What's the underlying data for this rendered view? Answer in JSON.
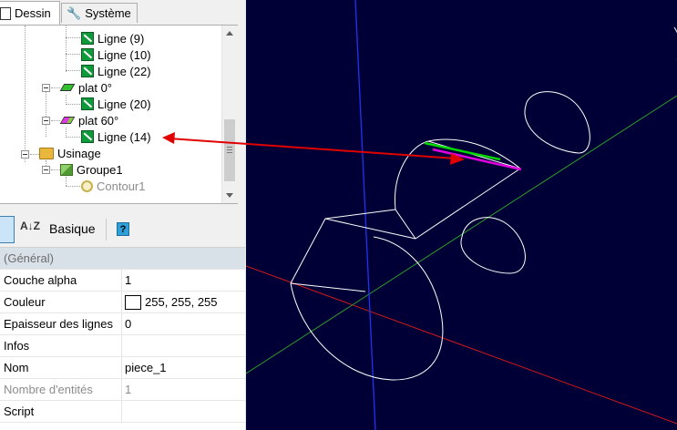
{
  "tabs": [
    {
      "label": "Dessin",
      "icon": "document-icon"
    },
    {
      "label": "Système",
      "icon": "wrench-icon"
    }
  ],
  "tree": {
    "items": [
      {
        "label": "Ligne (9)",
        "icon": "line-icon"
      },
      {
        "label": "Ligne (10)",
        "icon": "line-icon"
      },
      {
        "label": "Ligne (22)",
        "icon": "line-icon"
      },
      {
        "label": "plat 0°",
        "icon": "green-plane-icon"
      },
      {
        "label": "Ligne (20)",
        "icon": "line-icon"
      },
      {
        "label": "plat 60°",
        "icon": "magenta-plane-icon"
      },
      {
        "label": "Ligne (14)",
        "icon": "line-icon"
      },
      {
        "label": "Usinage",
        "icon": "folder-icon"
      },
      {
        "label": "Groupe1",
        "icon": "cube-icon"
      },
      {
        "label": "Contour1",
        "icon": "contour-icon"
      }
    ]
  },
  "toolbar": {
    "sort_label": "A↓Z",
    "basique_label": "Basique",
    "help_label": "?"
  },
  "properties": {
    "category": "(Général)",
    "rows": [
      {
        "name": "Couche alpha",
        "value": "1"
      },
      {
        "name": "Couleur",
        "value": "255, 255, 255",
        "swatch": "#ffffff"
      },
      {
        "name": "Epaisseur des lignes",
        "value": "0"
      },
      {
        "name": "Infos",
        "value": ""
      },
      {
        "name": "Nom",
        "value": "piece_1"
      },
      {
        "name": "Nombre d'entités",
        "value": "1",
        "gray": true
      },
      {
        "name": "Script",
        "value": ""
      }
    ]
  },
  "colors": {
    "viewport_bg": "#000036",
    "axis_x": "#d11a1a",
    "axis_y": "#2a9a2a",
    "axis_z": "#2233ee",
    "wire": "#ffffff",
    "highlight_green": "#00d800",
    "highlight_magenta": "#e000e0",
    "annotation_arrow": "#e00000"
  }
}
